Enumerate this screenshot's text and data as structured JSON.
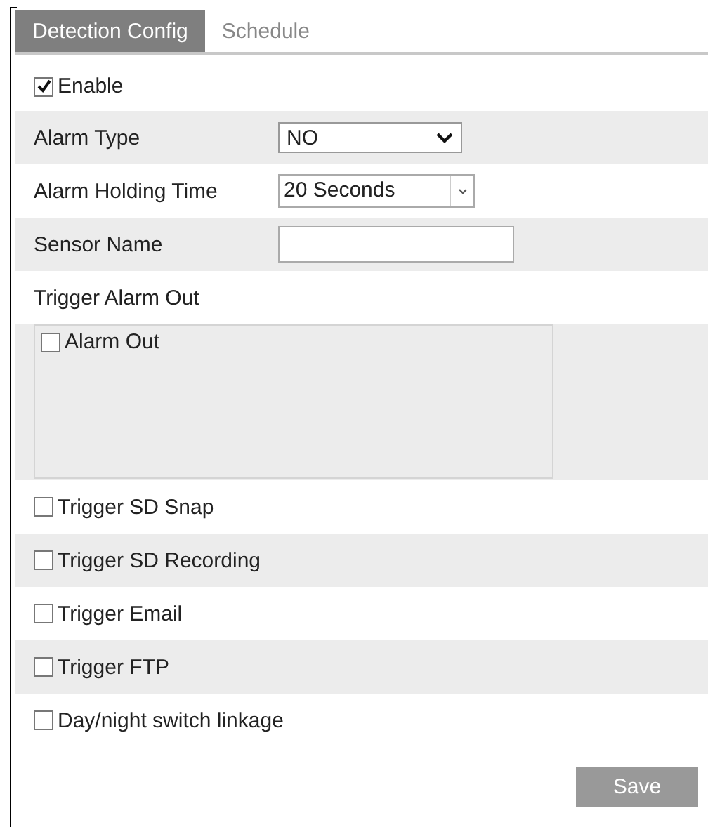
{
  "tabs": [
    {
      "label": "Detection Config",
      "selected": true
    },
    {
      "label": "Schedule",
      "selected": false
    }
  ],
  "rows": [
    {
      "kind": "checkbox",
      "label": "Enable",
      "checked": true
    },
    {
      "kind": "select",
      "label": "Alarm Type",
      "value": "NO"
    },
    {
      "kind": "combo",
      "label": "Alarm Holding Time",
      "value": "20 Seconds"
    },
    {
      "kind": "input",
      "label": "Sensor Name"
    },
    {
      "kind": "heading",
      "label": "Trigger Alarm Out"
    },
    {
      "kind": "list",
      "items": [
        {
          "label": "Alarm Out",
          "checked": false
        }
      ]
    },
    {
      "kind": "checkbox",
      "label": "Trigger SD Snap",
      "checked": false
    },
    {
      "kind": "checkbox",
      "label": "Trigger SD Recording",
      "checked": false
    },
    {
      "kind": "checkbox",
      "label": "Trigger Email",
      "checked": false
    },
    {
      "kind": "checkbox",
      "label": "Trigger FTP",
      "checked": false
    },
    {
      "kind": "checkbox",
      "label": "Day/night switch linkage",
      "checked": false
    }
  ],
  "save_button": "Save"
}
